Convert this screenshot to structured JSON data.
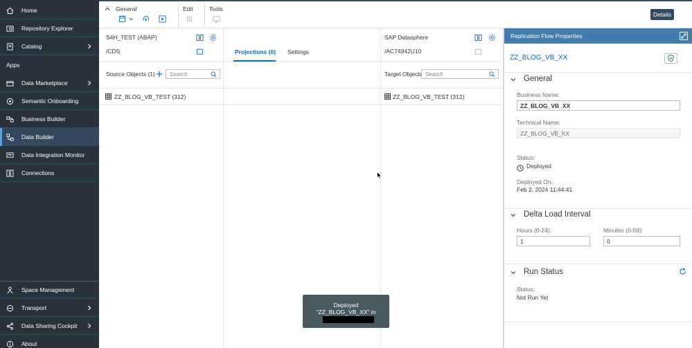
{
  "sidebar": {
    "items_top": [
      {
        "label": "Home",
        "icon": "home-icon"
      },
      {
        "label": "Repository Explorer",
        "icon": "repository-icon"
      },
      {
        "label": "Catalog",
        "icon": "catalog-icon"
      }
    ],
    "apps_header": "Apps",
    "items_apps": [
      {
        "label": "Data Marketplace",
        "icon": "marketplace-icon"
      },
      {
        "label": "Semantic Onboarding",
        "icon": "onboarding-icon"
      },
      {
        "label": "Business Builder",
        "icon": "business-builder-icon"
      },
      {
        "label": "Data Builder",
        "icon": "data-builder-icon"
      },
      {
        "label": "Data Integration Monitor",
        "icon": "monitor-icon"
      },
      {
        "label": "Connections",
        "icon": "connections-icon"
      }
    ],
    "items_bottom": [
      {
        "label": "Space Management",
        "icon": "space-icon"
      },
      {
        "label": "Transport",
        "icon": "transport-icon"
      },
      {
        "label": "Data Sharing Cockpit",
        "icon": "share-icon"
      },
      {
        "label": "About",
        "icon": "about-icon"
      }
    ]
  },
  "toolbar": {
    "group_general": "General",
    "group_edit": "Edit",
    "group_tools": "Tools",
    "details_label": "Details"
  },
  "source": {
    "connection": "S4H_TEST (ABAP)",
    "container": "/CDS",
    "header": "Source Objects (1)",
    "search_placeholder": "Search",
    "object": "ZZ_BLOG_VB_TEST (312)"
  },
  "middle": {
    "tabs": [
      {
        "label": "Projections (0)",
        "active": true
      },
      {
        "label": "Settings",
        "active": false
      }
    ]
  },
  "target": {
    "connection": "SAP Datasphere",
    "container": "/AC74942U10",
    "header": "Target Objects",
    "search_placeholder": "Search",
    "object": "ZZ_BLOG_VB_TEST (312)"
  },
  "properties": {
    "title": "Replication Flow Properties",
    "object_name": "ZZ_BLOG_VB_XX",
    "general": {
      "title": "General",
      "business_name_label": "Business Name:",
      "business_name_value": "ZZ_BLOG_VB_XX",
      "technical_name_label": "Technical Name:",
      "technical_name_value": "ZZ_BLOG_VB_XX",
      "status_label": "Status:",
      "status_value": "Deployed",
      "deployed_on_label": "Deployed On:",
      "deployed_on_value": "Feb 2, 2024 11:44:41"
    },
    "delta": {
      "title": "Delta Load Interval",
      "hours_label": "Hours (0-24):",
      "hours_value": "1",
      "minutes_label": "Minutes (0-59):",
      "minutes_value": "0"
    },
    "run": {
      "title": "Run Status",
      "status_label": "Status:",
      "status_value": "Not Run Yet"
    }
  },
  "toast": {
    "line1": "Deployed",
    "line2": "\"ZZ_BLOG_VB_XX\" in"
  },
  "colors": {
    "sidebar_bg": "#29313a",
    "accent": "#0a6ed1",
    "props_header": "#427cac"
  }
}
